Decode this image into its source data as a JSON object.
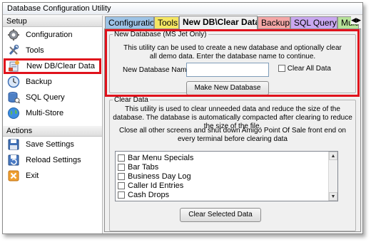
{
  "window": {
    "title": "Database Configuration Utility"
  },
  "sidebar": {
    "setup_header": "Setup",
    "setup_items": [
      {
        "label": "Configuration",
        "icon": "gear-icon"
      },
      {
        "label": "Tools",
        "icon": "tools-icon"
      },
      {
        "label": "New DB/Clear Data",
        "icon": "new-database-icon"
      },
      {
        "label": "Backup",
        "icon": "clock-icon"
      },
      {
        "label": "SQL Query",
        "icon": "database-icon"
      },
      {
        "label": "Multi-Store",
        "icon": "globe-icon"
      }
    ],
    "actions_header": "Actions",
    "action_items": [
      {
        "label": "Save Settings",
        "icon": "save-icon"
      },
      {
        "label": "Reload Settings",
        "icon": "reload-icon"
      },
      {
        "label": "Exit",
        "icon": "exit-icon"
      }
    ]
  },
  "tabs": [
    {
      "label": "Configuration",
      "color": "#9dc3e6"
    },
    {
      "label": "Tools",
      "color": "#f5e663"
    },
    {
      "label": "New DB\\Clear Data",
      "color": "#f0f0f0"
    },
    {
      "label": "Backup",
      "color": "#f4a7a7"
    },
    {
      "label": "SQL Query",
      "color": "#c9a8f0"
    },
    {
      "label": "Multi-S",
      "color": "#b7e39a"
    }
  ],
  "new_database": {
    "legend": "New Database (MS Jet Only)",
    "description": "This utility can be used to create a new database and optionally clear all demo data. Enter the database name to continue.",
    "name_label": "New Database Name:",
    "name_value": "",
    "clear_all_label": "Clear All Data",
    "make_button": "Make New Database"
  },
  "clear_data": {
    "legend": "Clear Data",
    "description": "This utility is used to clear unneeded data and reduce the size of the database. The database is automatically compacted after clearing to reduce the size of the file.",
    "warning": "Close all other screens and shut down Amigo Point Of Sale front end on every terminal before clearing data",
    "items": [
      "Bar Menu Specials",
      "Bar Tabs",
      "Business Day Log",
      "Caller Id Entries",
      "Cash Drops"
    ],
    "clear_button": "Clear Selected Data"
  },
  "colors": {
    "highlight": "#e0121c"
  }
}
